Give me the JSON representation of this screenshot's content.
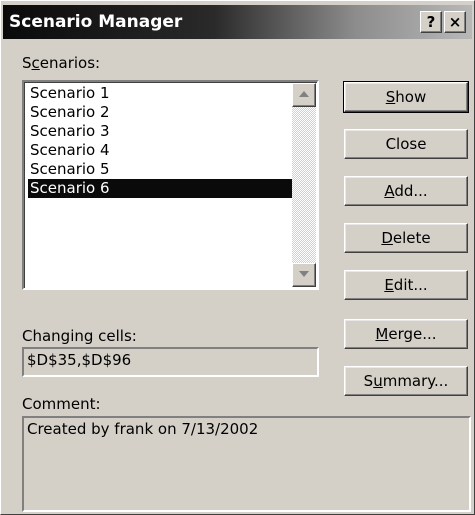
{
  "window": {
    "title": "Scenario Manager"
  },
  "titlebar": {
    "help_label": "?",
    "close_label": "×"
  },
  "scenarios": {
    "label_pre": "S",
    "label_ul": "c",
    "label_post": "enarios:",
    "items": [
      {
        "label": "Scenario 1",
        "selected": false
      },
      {
        "label": "Scenario 2",
        "selected": false
      },
      {
        "label": "Scenario 3",
        "selected": false
      },
      {
        "label": "Scenario 4",
        "selected": false
      },
      {
        "label": "Scenario 5",
        "selected": false
      },
      {
        "label": "Scenario 6",
        "selected": true
      }
    ]
  },
  "buttons": {
    "show": {
      "pre": "",
      "ul": "S",
      "post": "how"
    },
    "close": {
      "pre": "Close",
      "ul": "",
      "post": ""
    },
    "add": {
      "pre": "",
      "ul": "A",
      "post": "dd..."
    },
    "delete": {
      "pre": "",
      "ul": "D",
      "post": "elete"
    },
    "edit": {
      "pre": "",
      "ul": "E",
      "post": "dit..."
    },
    "merge": {
      "pre": "",
      "ul": "M",
      "post": "erge..."
    },
    "summary": {
      "pre": "S",
      "ul": "u",
      "post": "mmary..."
    }
  },
  "changing_cells": {
    "label": "Changing cells:",
    "value": "$D$35,$D$96"
  },
  "comment": {
    "label": "Comment:",
    "value": "Created by frank on 7/13/2002"
  },
  "colors": {
    "selection": "#0a0a0a",
    "face": "#d4d0c8"
  }
}
